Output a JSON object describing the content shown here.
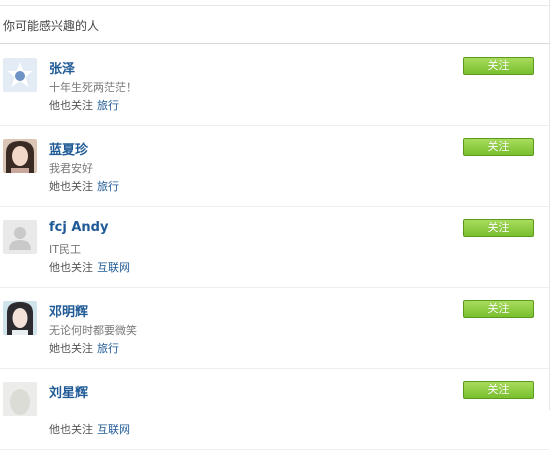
{
  "header": {
    "title": "你可能感兴趣的人"
  },
  "people": [
    {
      "name": "张泽",
      "bio": "十年生死两茫茫！",
      "meta_prefix": "他也关注",
      "tag": "旅行",
      "follow_label": "关注",
      "avatar": "default-blue-icon"
    },
    {
      "name": "蓝夏珍",
      "bio": "我君安好",
      "meta_prefix": "她也关注",
      "tag": "旅行",
      "follow_label": "关注",
      "avatar": "user-photo"
    },
    {
      "name": "fcj Andy",
      "bio": "IT民工",
      "meta_prefix": "他也关注",
      "tag": "互联网",
      "follow_label": "关注",
      "avatar": "default-gray-person-icon"
    },
    {
      "name": "邓明辉",
      "bio": "无论何时都要微笑",
      "meta_prefix": "她也关注",
      "tag": "旅行",
      "follow_label": "关注",
      "avatar": "user-photo"
    },
    {
      "name": "刘星辉",
      "bio": "",
      "meta_prefix": "他也关注",
      "tag": "互联网",
      "follow_label": "关注",
      "avatar": "user-photo"
    }
  ],
  "colors": {
    "name_link": "#1f5a96",
    "follow_button": "#79bf2e"
  }
}
